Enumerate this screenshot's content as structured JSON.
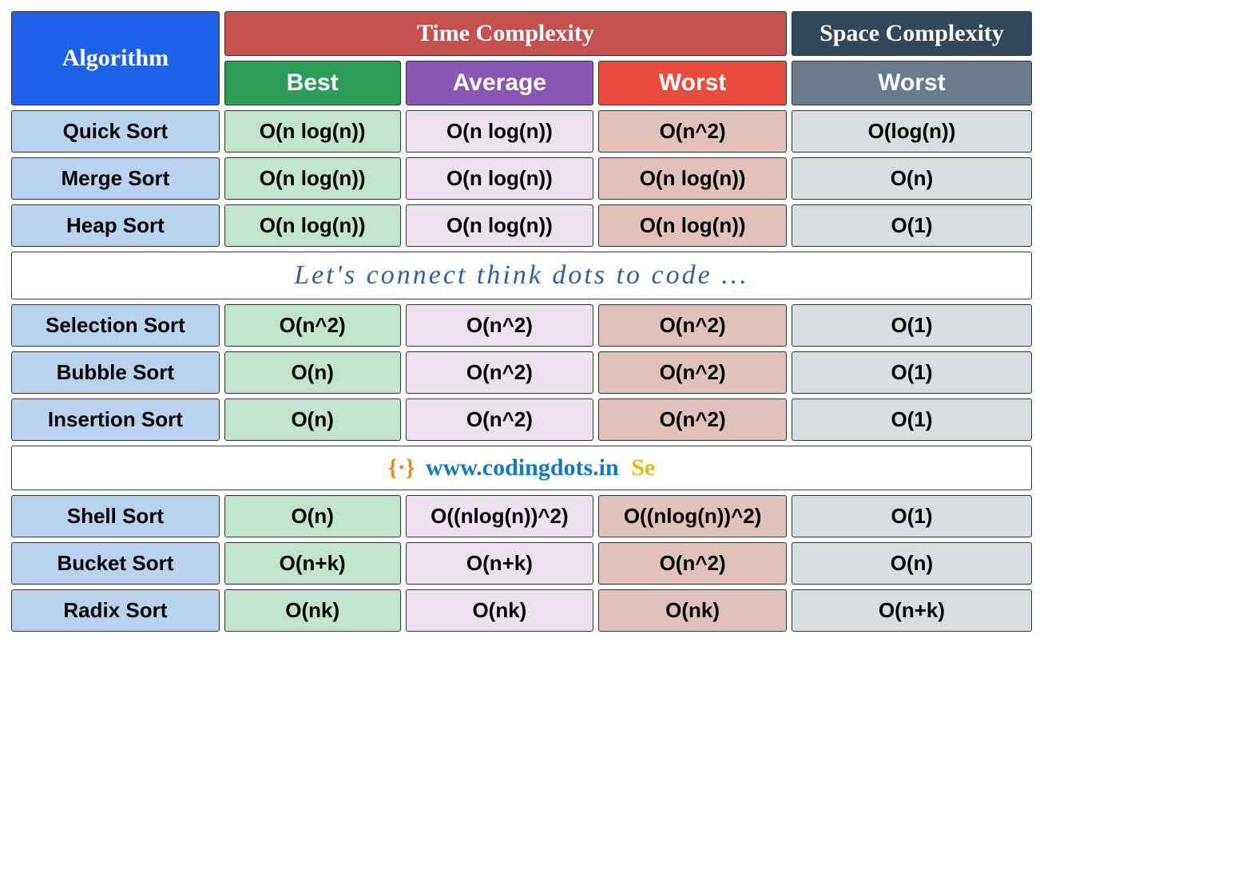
{
  "header": {
    "algorithm": "Algorithm",
    "time": "Time Complexity",
    "space": "Space Complexity",
    "best": "Best",
    "average": "Average",
    "worst": "Worst",
    "space_worst": "Worst"
  },
  "banners": {
    "tagline": "Let's connect think dots to code ...",
    "url": "www.codingdots.in",
    "icon_left": "{·}",
    "icon_right": "Se"
  },
  "rows": {
    "g1": [
      {
        "name": "Quick Sort",
        "best": "O(n log(n))",
        "avg": "O(n log(n))",
        "worst": "O(n^2)",
        "space": "O(log(n))"
      },
      {
        "name": "Merge Sort",
        "best": "O(n log(n))",
        "avg": "O(n log(n))",
        "worst": "O(n log(n))",
        "space": "O(n)"
      },
      {
        "name": "Heap Sort",
        "best": "O(n log(n))",
        "avg": "O(n log(n))",
        "worst": "O(n log(n))",
        "space": "O(1)"
      }
    ],
    "g2": [
      {
        "name": "Selection Sort",
        "best": "O(n^2)",
        "avg": "O(n^2)",
        "worst": "O(n^2)",
        "space": "O(1)"
      },
      {
        "name": "Bubble Sort",
        "best": "O(n)",
        "avg": "O(n^2)",
        "worst": "O(n^2)",
        "space": "O(1)"
      },
      {
        "name": "Insertion Sort",
        "best": "O(n)",
        "avg": "O(n^2)",
        "worst": "O(n^2)",
        "space": "O(1)"
      }
    ],
    "g3": [
      {
        "name": "Shell Sort",
        "best": "O(n)",
        "avg": "O((nlog(n))^2)",
        "worst": "O((nlog(n))^2)",
        "space": "O(1)"
      },
      {
        "name": "Bucket Sort",
        "best": "O(n+k)",
        "avg": "O(n+k)",
        "worst": "O(n^2)",
        "space": "O(n)"
      },
      {
        "name": "Radix Sort",
        "best": "O(nk)",
        "avg": "O(nk)",
        "worst": "O(nk)",
        "space": "O(n+k)"
      }
    ]
  },
  "chart_data": {
    "type": "table",
    "title": "Sorting Algorithm Time & Space Complexity",
    "columns": [
      "Algorithm",
      "Time Best",
      "Time Average",
      "Time Worst",
      "Space Worst"
    ],
    "rows": [
      [
        "Quick Sort",
        "O(n log(n))",
        "O(n log(n))",
        "O(n^2)",
        "O(log(n))"
      ],
      [
        "Merge Sort",
        "O(n log(n))",
        "O(n log(n))",
        "O(n log(n))",
        "O(n)"
      ],
      [
        "Heap Sort",
        "O(n log(n))",
        "O(n log(n))",
        "O(n log(n))",
        "O(1)"
      ],
      [
        "Selection Sort",
        "O(n^2)",
        "O(n^2)",
        "O(n^2)",
        "O(1)"
      ],
      [
        "Bubble Sort",
        "O(n)",
        "O(n^2)",
        "O(n^2)",
        "O(1)"
      ],
      [
        "Insertion Sort",
        "O(n)",
        "O(n^2)",
        "O(n^2)",
        "O(1)"
      ],
      [
        "Shell Sort",
        "O(n)",
        "O((nlog(n))^2)",
        "O((nlog(n))^2)",
        "O(1)"
      ],
      [
        "Bucket Sort",
        "O(n+k)",
        "O(n+k)",
        "O(n^2)",
        "O(n)"
      ],
      [
        "Radix Sort",
        "O(nk)",
        "O(nk)",
        "O(nk)",
        "O(n+k)"
      ]
    ]
  }
}
